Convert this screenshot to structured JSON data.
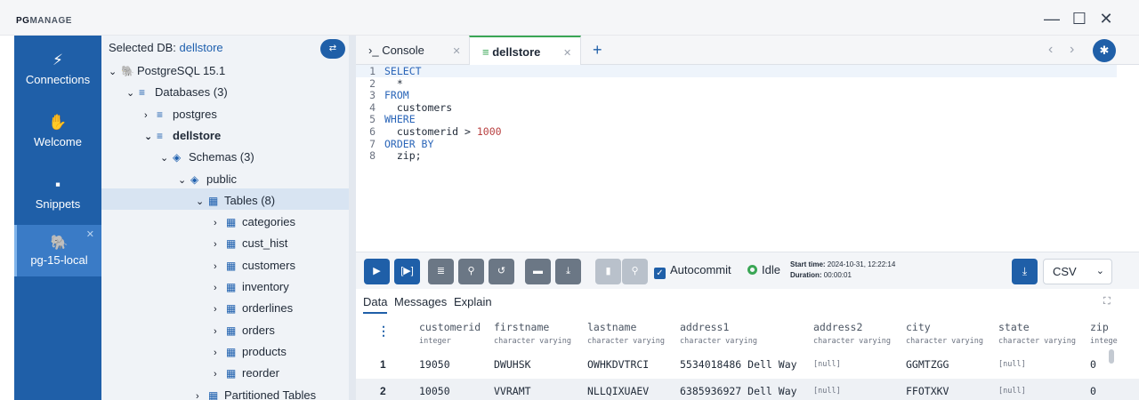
{
  "app": {
    "logo_a": "PG",
    "logo_b": "MANAGE"
  },
  "window": {
    "minimize": "—",
    "maximize": "☐",
    "close": "✕"
  },
  "nav": {
    "items": [
      {
        "label": "Connections",
        "icon": "⚡"
      },
      {
        "label": "Welcome",
        "icon": "✋"
      },
      {
        "label": "Snippets",
        "icon": "▪"
      }
    ],
    "connection": {
      "label": "pg-15-local",
      "icon": "🐘",
      "close": "✕"
    }
  },
  "tree": {
    "selected_db_label": "Selected DB: ",
    "selected_db": "dellstore",
    "nodes": [
      {
        "label": "PostgreSQL 15.1",
        "chev": "⌄",
        "icon": "🐘"
      },
      {
        "label": "Databases (3)",
        "chev": "⌄",
        "icon": "≡"
      },
      {
        "label": "postgres",
        "chev": "›",
        "icon": "≡"
      },
      {
        "label": "dellstore",
        "chev": "⌄",
        "icon": "≡"
      },
      {
        "label": "Schemas (3)",
        "chev": "⌄",
        "icon": "◈"
      },
      {
        "label": "public",
        "chev": "⌄",
        "icon": "◈"
      },
      {
        "label": "Tables (8)",
        "chev": "⌄",
        "icon": "▦"
      },
      {
        "label": "categories",
        "chev": "›",
        "icon": "▦"
      },
      {
        "label": "cust_hist",
        "chev": "›",
        "icon": "▦"
      },
      {
        "label": "customers",
        "chev": "›",
        "icon": "▦"
      },
      {
        "label": "inventory",
        "chev": "›",
        "icon": "▦"
      },
      {
        "label": "orderlines",
        "chev": "›",
        "icon": "▦"
      },
      {
        "label": "orders",
        "chev": "›",
        "icon": "▦"
      },
      {
        "label": "products",
        "chev": "›",
        "icon": "▦"
      },
      {
        "label": "reorder",
        "chev": "›",
        "icon": "▦"
      },
      {
        "label": "Partitioned Tables",
        "chev": "›",
        "icon": "▦"
      }
    ]
  },
  "tabs": {
    "console": {
      "label": "Console",
      "prompt": "›_"
    },
    "dellstore": {
      "label": "dellstore",
      "icon": "≡"
    },
    "close": "✕",
    "add": "+"
  },
  "editor": {
    "lines": [
      {
        "n": "1",
        "a": "SELECT",
        "b": ""
      },
      {
        "n": "2",
        "a": "  *",
        "b": ""
      },
      {
        "n": "3",
        "a": "FROM",
        "b": ""
      },
      {
        "n": "4",
        "a": "  customers",
        "b": ""
      },
      {
        "n": "5",
        "a": "WHERE",
        "b": ""
      },
      {
        "n": "6",
        "a": "  customerid > ",
        "b": "1000"
      },
      {
        "n": "7",
        "a": "ORDER BY",
        "b": ""
      },
      {
        "n": "8",
        "a": "  zip;",
        "b": ""
      }
    ]
  },
  "toolbar": {
    "autocommit": "Autocommit",
    "status": "Idle",
    "start_label": "Start time:",
    "start_value": " 2024-10-31, 12:22:14",
    "duration_label": "Duration:",
    "duration_value": " 00:00:01",
    "format": "CSV"
  },
  "result_tabs": [
    "Data",
    "Messages",
    "Explain"
  ],
  "grid": {
    "columns": [
      {
        "name": "customerid",
        "type": "integer"
      },
      {
        "name": "firstname",
        "type": "character varying"
      },
      {
        "name": "lastname",
        "type": "character varying"
      },
      {
        "name": "address1",
        "type": "character varying"
      },
      {
        "name": "address2",
        "type": "character varying"
      },
      {
        "name": "city",
        "type": "character varying"
      },
      {
        "name": "state",
        "type": "character varying"
      },
      {
        "name": "zip",
        "type": "intege"
      }
    ],
    "rows": [
      {
        "num": "1",
        "cells": [
          "19050",
          "DWUHSK",
          "OWHKDVTRCI",
          "5534018486 Dell Way",
          "[null]",
          "GGMTZGG",
          "[null]",
          "0"
        ]
      },
      {
        "num": "2",
        "cells": [
          "10050",
          "VVRAMT",
          "NLLQIXUAEV",
          "6385936927 Dell Way",
          "[null]",
          "FFOTXKV",
          "[null]",
          "0"
        ]
      }
    ]
  }
}
